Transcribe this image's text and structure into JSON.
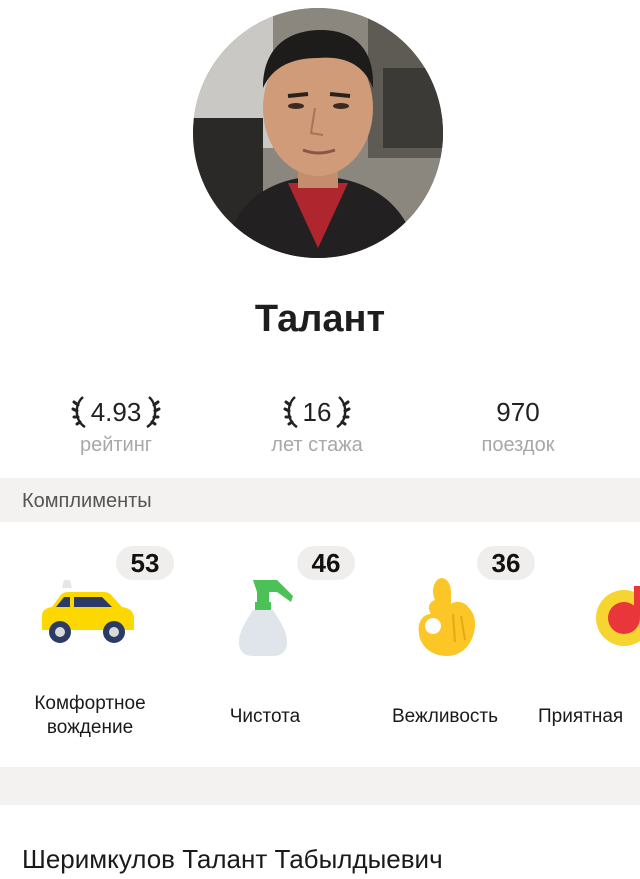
{
  "driver": {
    "name": "Талант",
    "full_name": "Шеримкулов Талант Табылдыевич"
  },
  "stats": [
    {
      "value": "4.93",
      "label": "рейтинг",
      "laurels": true
    },
    {
      "value": "16",
      "label": "лет стажа",
      "laurels": true
    },
    {
      "value": "970",
      "label": "поездок",
      "laurels": false
    }
  ],
  "compliments": {
    "title": "Комплименты",
    "items": [
      {
        "count": "53",
        "line1": "Комфортное",
        "line2": "вождение",
        "icon": "car-icon"
      },
      {
        "count": "46",
        "line1": "Чистота",
        "line2": "",
        "icon": "spray-bottle-icon"
      },
      {
        "count": "36",
        "line1": "Вежливость",
        "line2": "",
        "icon": "ok-hand-icon"
      },
      {
        "count": "",
        "line1": "Приятная",
        "line2": "",
        "icon": "music-icon"
      }
    ]
  },
  "colors": {
    "accent_yellow": "#fcd800",
    "section_bg": "#f3f2f0",
    "muted_text": "#a8a8a8"
  }
}
